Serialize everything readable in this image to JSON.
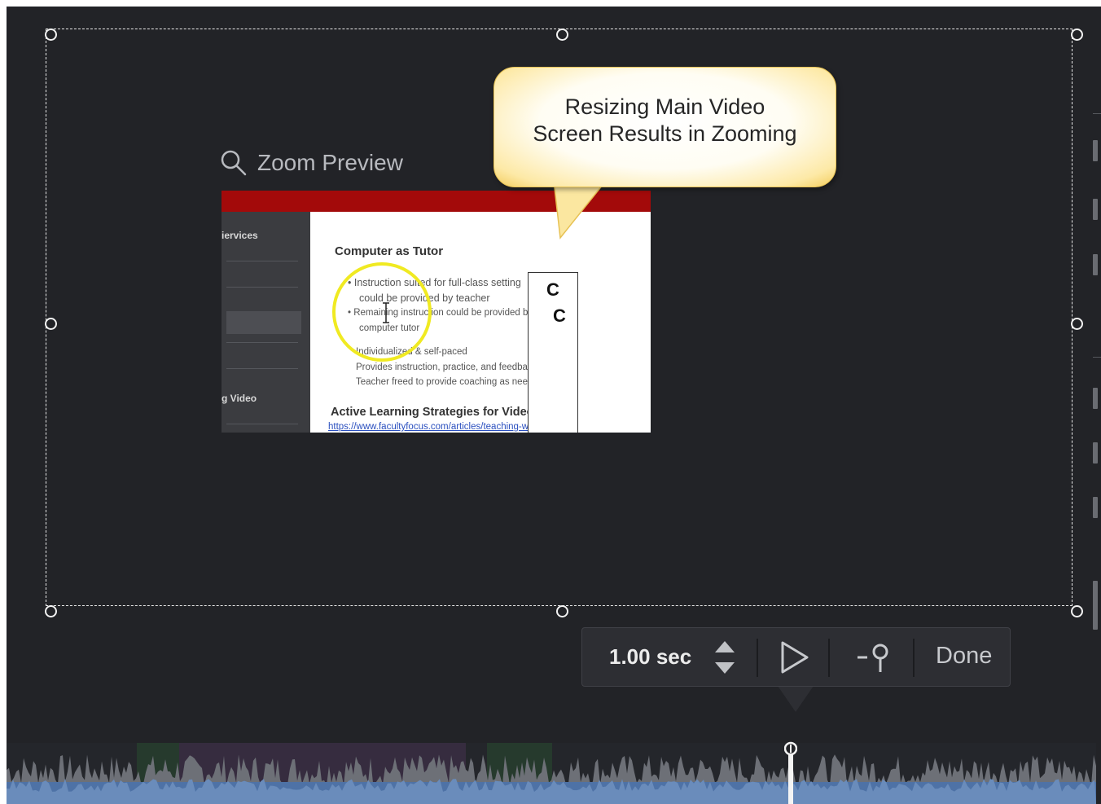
{
  "zoom_preview": {
    "label": "Zoom Preview",
    "icon": "search-icon"
  },
  "callout": {
    "line1": "Resizing Main Video",
    "line2": "Screen Results in Zooming"
  },
  "thumbnail": {
    "sidebar_items": [
      "iervices",
      "g Video"
    ],
    "heading": "Computer as Tutor",
    "bullets": [
      "Instruction suited for full-class setting",
      "could be provided by teacher",
      "Remaining instruction could be provided by",
      "computer tutor"
    ],
    "lines": [
      "Individualized & self-paced",
      "Provides instruction, practice, and feedback",
      "Teacher freed to provide coaching as needed"
    ],
    "subheading": "Active Learning Strategies for Video",
    "link": "https://www.facultyfocus.com/articles/teaching-with-",
    "box_letters": [
      "C",
      "C"
    ]
  },
  "toolbar": {
    "duration": "1.00 sec",
    "done_label": "Done",
    "icons": [
      "stepper-icon",
      "play-icon",
      "pin-icon"
    ]
  },
  "colors": {
    "canvas": "#222327",
    "frame": "#e8e8e8",
    "toolbar": "#2d2e33",
    "waveform": "#4e72a6",
    "highlight": "#f0ea22",
    "slide_bar": "#a30a0a"
  }
}
